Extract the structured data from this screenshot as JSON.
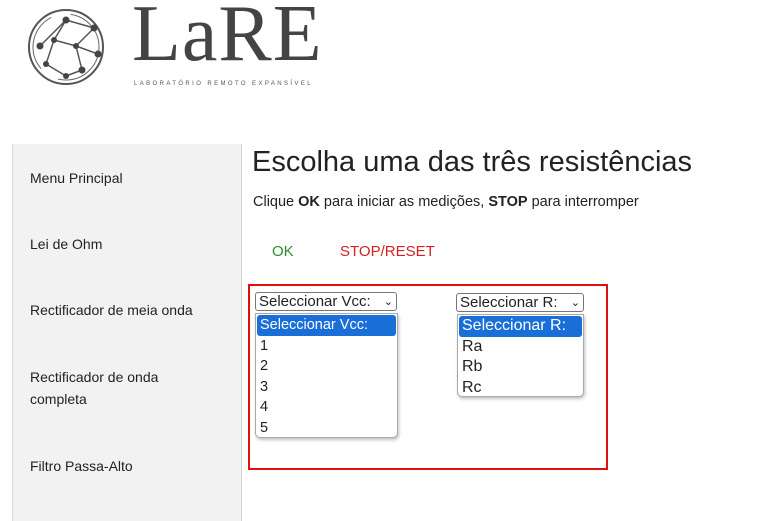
{
  "logo": {
    "word": "LaRE",
    "tagline": "LABORATÓRIO REMOTO EXPANSÍVEL"
  },
  "sidebar": {
    "items": [
      {
        "label": "Menu Principal"
      },
      {
        "label": "Lei de Ohm"
      },
      {
        "label": "Rectificador de meia onda"
      },
      {
        "label": "Rectificador de onda completa"
      },
      {
        "label": "Filtro Passa-Alto"
      }
    ]
  },
  "main": {
    "title": "Escolha uma das três resistências",
    "instruction": {
      "prefix": "Clique ",
      "ok_word": "OK",
      "middle": " para iniciar as medições, ",
      "stop_word": "STOP",
      "suffix": " para interromper"
    },
    "ok_label": "OK",
    "stop_label": "STOP/RESET",
    "vcc_select": {
      "selected": "Seleccionar Vcc:",
      "options": [
        "Seleccionar Vcc:",
        "1",
        "2",
        "3",
        "4",
        "5"
      ]
    },
    "r_select": {
      "selected": "Seleccionar R:",
      "options": [
        "Seleccionar R:",
        "Ra",
        "Rb",
        "Rc"
      ]
    }
  },
  "colors": {
    "ok": "#2e8b2e",
    "stop": "#d42020",
    "frame": "#e01010",
    "option_highlight": "#1a6ed8"
  }
}
